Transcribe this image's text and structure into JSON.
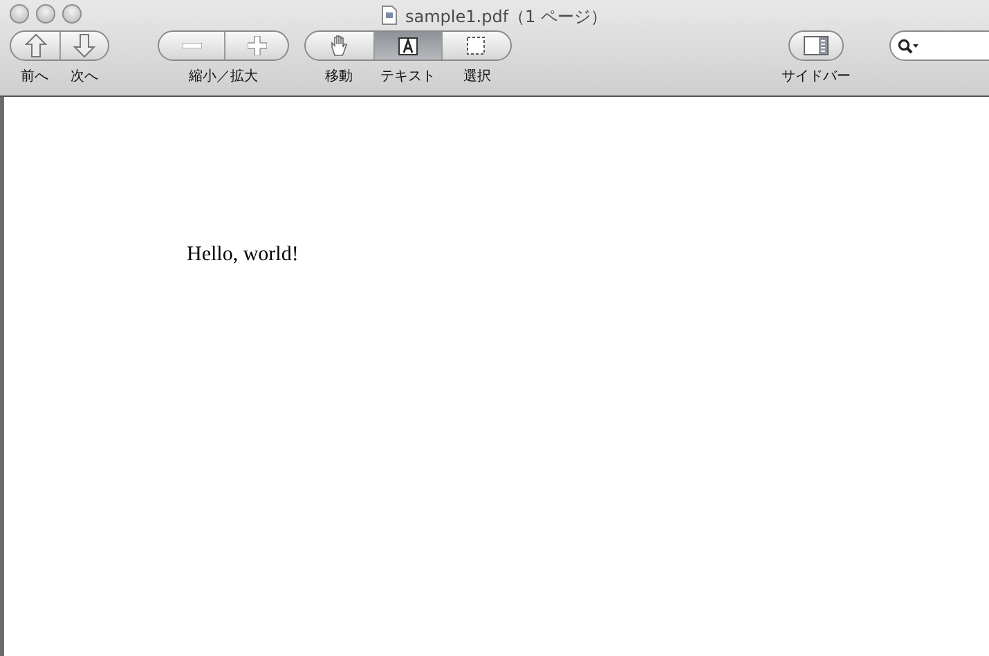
{
  "window": {
    "title": "sample1.pdf（1 ページ）"
  },
  "toolbar": {
    "navigation": [
      {
        "label": "前へ"
      },
      {
        "label": "次へ"
      }
    ],
    "zoom": {
      "label": "縮小／拡大"
    },
    "tools": [
      {
        "label": "移動",
        "selected": false
      },
      {
        "label": "テキスト",
        "selected": true
      },
      {
        "label": "選択",
        "selected": false
      }
    ],
    "sidebar": {
      "label": "サイドバー"
    }
  },
  "document": {
    "text": "Hello, world!"
  }
}
